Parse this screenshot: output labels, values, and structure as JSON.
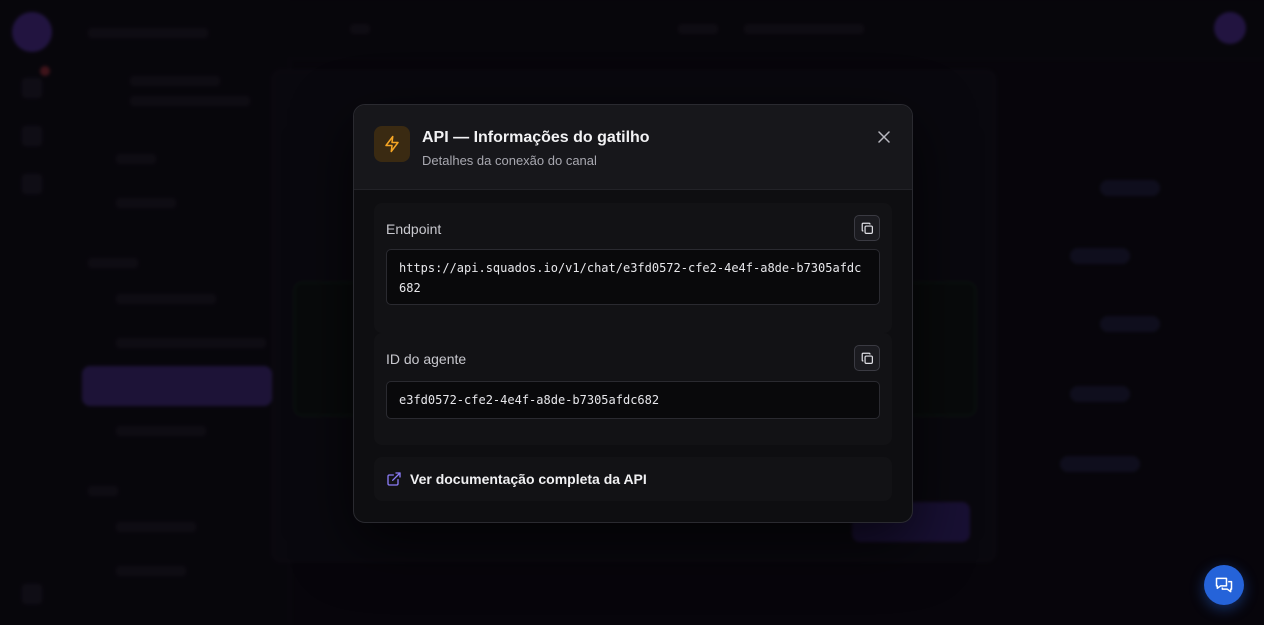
{
  "modal": {
    "title": "API — Informações do gatilho",
    "subtitle": "Detalhes da conexão do canal",
    "header_icon": "lightning-icon",
    "close_icon": "close-icon",
    "accent_color": "#f5a524"
  },
  "endpoint": {
    "label": "Endpoint",
    "value": "https://api.squados.io/v1/chat/e3fd0572-cfe2-4e4f-a8de-b7305afdc682",
    "copy_icon": "copy-icon"
  },
  "agent_id": {
    "label": "ID do agente",
    "value": "e3fd0572-cfe2-4e4f-a8de-b7305afdc682",
    "copy_icon": "copy-icon"
  },
  "docs_link": {
    "label": "Ver documentação completa da API",
    "icon": "external-link-icon",
    "icon_color": "#8b7cf6"
  },
  "chat_button": {
    "icon": "chat-bubbles-icon",
    "color": "#2563d9"
  }
}
